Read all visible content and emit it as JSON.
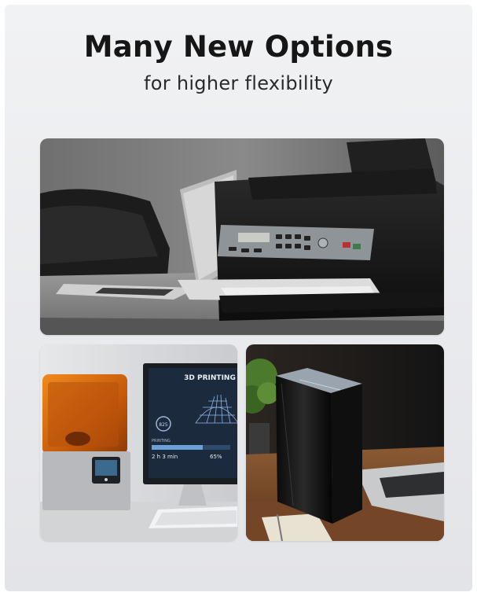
{
  "headline": {
    "title": "Many New Options",
    "subtitle": "for higher flexibility"
  },
  "photos": {
    "printer": {
      "subject": "office-printer-with-laptop"
    },
    "printer3d": {
      "subject": "3d-printer-with-monitor",
      "screen_title": "3D PRINTING",
      "screen_value": "825",
      "screen_status": "PRINTING",
      "screen_time": "2 h 3 min",
      "screen_percent": "65%"
    },
    "nas": {
      "subject": "storage-drive-on-desk"
    }
  }
}
